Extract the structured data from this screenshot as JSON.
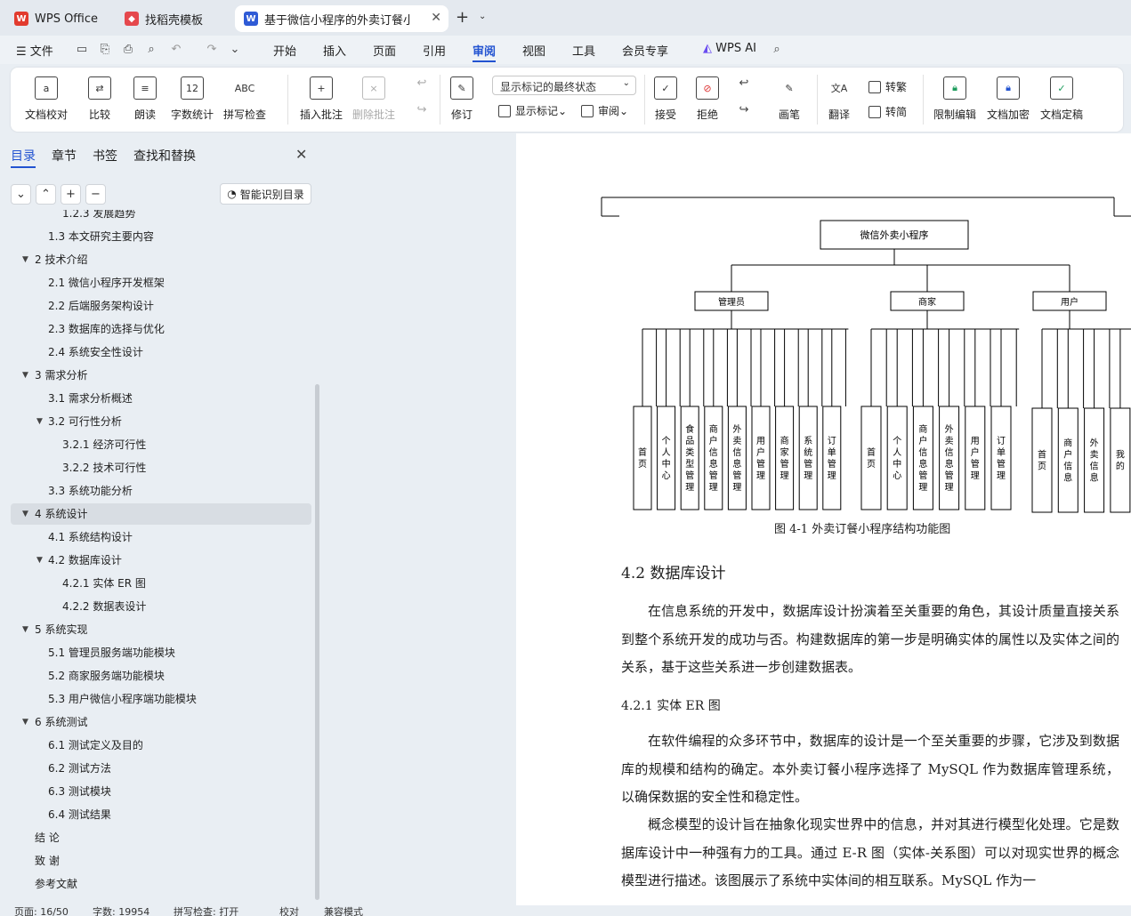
{
  "tabs": [
    {
      "label": "WPS Office"
    },
    {
      "label": "找稻壳模板"
    },
    {
      "label": "基于微信小程序的外卖订餐小"
    }
  ],
  "menu": {
    "file": "文件",
    "items": [
      "开始",
      "插入",
      "页面",
      "引用",
      "审阅",
      "视图",
      "工具",
      "会员专享"
    ],
    "active": "审阅",
    "ai": "WPS AI"
  },
  "ribbon": {
    "doc_check": "文档校对",
    "compare": "比较",
    "read": "朗读",
    "word_count": "字数统计",
    "spell": "拼写检查",
    "insert_comment": "插入批注",
    "delete_comment": "删除批注",
    "revise": "修订",
    "markup_select": "显示标记的最终状态",
    "show_markup": "显示标记",
    "review": "审阅",
    "accept": "接受",
    "reject": "拒绝",
    "pen": "画笔",
    "translate": "翻译",
    "to_trad": "转繁",
    "to_simp": "转简",
    "restrict": "限制编辑",
    "encrypt": "文档加密",
    "finalize": "文档定稿"
  },
  "panel": {
    "tabs": [
      "目录",
      "章节",
      "书签",
      "查找和替换"
    ],
    "smart": "智能识别目录"
  },
  "toc": [
    {
      "t": "1.2.3  发展趋势",
      "lv": 2
    },
    {
      "t": "1.3  本文研究主要内容",
      "lv": 1
    },
    {
      "t": "2  技术介绍",
      "lv": 0
    },
    {
      "t": "2.1  微信小程序开发框架",
      "lv": 1
    },
    {
      "t": "2.2  后端服务架构设计",
      "lv": 1
    },
    {
      "t": "2.3  数据库的选择与优化",
      "lv": 1
    },
    {
      "t": "2.4  系统安全性设计",
      "lv": 1
    },
    {
      "t": "3  需求分析",
      "lv": 0
    },
    {
      "t": "3.1  需求分析概述",
      "lv": 1
    },
    {
      "t": "3.2  可行性分析",
      "lv": 1,
      "exp": true
    },
    {
      "t": "3.2.1  经济可行性",
      "lv": 2
    },
    {
      "t": "3.2.2  技术可行性",
      "lv": 2
    },
    {
      "t": "3.3  系统功能分析",
      "lv": 1
    },
    {
      "t": "4  系统设计",
      "lv": 0,
      "sel": true
    },
    {
      "t": "4.1 系统结构设计",
      "lv": 1
    },
    {
      "t": "4.2  数据库设计",
      "lv": 1,
      "exp": true
    },
    {
      "t": "4.2.1  实体 ER 图",
      "lv": 2
    },
    {
      "t": "4.2.2  数据表设计",
      "lv": 2
    },
    {
      "t": "5  系统实现",
      "lv": 0
    },
    {
      "t": "5.1  管理员服务端功能模块",
      "lv": 1
    },
    {
      "t": "5.2  商家服务端功能模块",
      "lv": 1
    },
    {
      "t": "5.3 用户微信小程序端功能模块",
      "lv": 1
    },
    {
      "t": " 6  系统测试",
      "lv": 0
    },
    {
      "t": "6.1  测试定义及目的",
      "lv": 1
    },
    {
      "t": "6.2  测试方法",
      "lv": 1
    },
    {
      "t": "6.3  测试模块",
      "lv": 1
    },
    {
      "t": "6.4  测试结果",
      "lv": 1
    },
    {
      "t": "结    论",
      "lv": 0,
      "noarr": true
    },
    {
      "t": "致    谢",
      "lv": 0,
      "noarr": true
    },
    {
      "t": "参考文献",
      "lv": 0,
      "noarr": true
    }
  ],
  "diagram": {
    "root": "微信外卖小程序",
    "groups": [
      {
        "name": "管理员",
        "children": [
          "首页",
          "个人中心",
          "食品类型管理",
          "商户信息管理",
          "外卖信息管理",
          "用户管理",
          "商家管理",
          "系统管理",
          "订单管理"
        ]
      },
      {
        "name": "商家",
        "children": [
          "首页",
          "个人中心",
          "商户信息管理",
          "外卖信息管理",
          "用户管理",
          "订单管理"
        ]
      },
      {
        "name": "用户",
        "children": [
          "首页",
          "商户信息",
          "外卖信息",
          "我的"
        ]
      }
    ],
    "caption": "图 4-1 外卖订餐小程序结构功能图"
  },
  "doc": {
    "h2": "4.2  数据库设计",
    "p1": "在信息系统的开发中，数据库设计扮演着至关重要的角色，其设计质量直接关系到整个系统开发的成功与否。构建数据库的第一步是明确实体的属性以及实体之间的关系，基于这些关系进一步创建数据表。",
    "h3": "4.2.1  实体 ER 图",
    "p2": "在软件编程的众多环节中，数据库的设计是一个至关重要的步骤，它涉及到数据库的规模和结构的确定。本外卖订餐小程序选择了 MySQL 作为数据库管理系统，以确保数据的安全性和稳定性。",
    "p3": "概念模型的设计旨在抽象化现实世界中的信息，并对其进行模型化处理。它是数据库设计中一种强有力的工具。通过 E-R 图（实体-关系图）可以对现实世界的概念模型进行描述。该图展示了系统中实体间的相互联系。MySQL 作为一"
  },
  "status": {
    "page": "页面: 16/50",
    "words": "字数: 19954",
    "spell": "拼写检查: 打开",
    "proof": "校对",
    "mode": "兼容模式"
  }
}
